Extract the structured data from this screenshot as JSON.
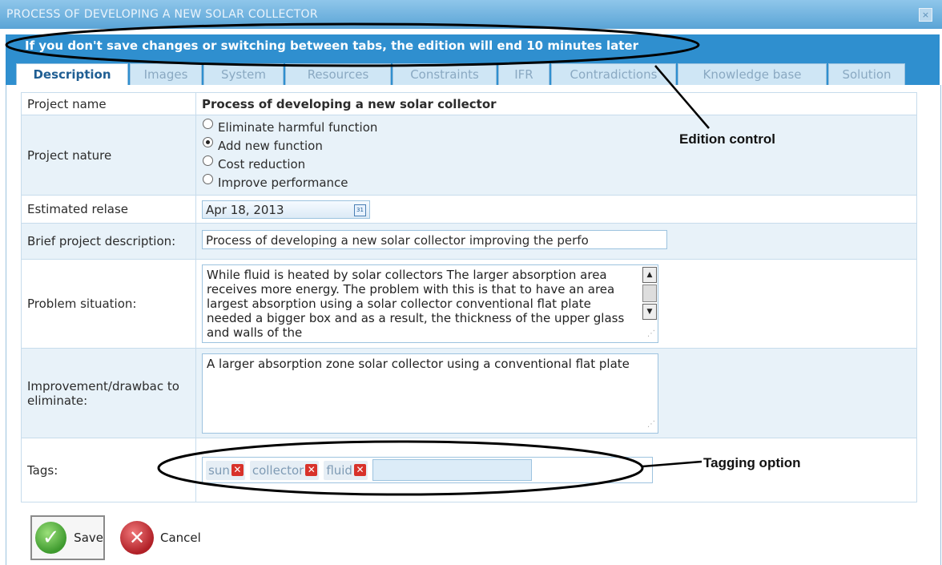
{
  "window": {
    "title": "PROCESS OF DEVELOPING A NEW SOLAR COLLECTOR",
    "close_glyph": "×"
  },
  "banner": "If you don't save changes or switching between tabs, the edition will end 10 minutes later",
  "tabs": [
    {
      "label": "Description",
      "active": true
    },
    {
      "label": "Images"
    },
    {
      "label": "System"
    },
    {
      "label": "Resources"
    },
    {
      "label": "Constraints"
    },
    {
      "label": "IFR"
    },
    {
      "label": "Contradictions"
    },
    {
      "label": "Knowledge base"
    },
    {
      "label": "Solution"
    }
  ],
  "form": {
    "project_name": {
      "label": "Project name",
      "value": "Process of developing a new solar collector"
    },
    "project_nature": {
      "label": "Project nature",
      "options": [
        "Eliminate harmful function",
        "Add new function",
        "Cost reduction",
        "Improve performance"
      ],
      "selected": "Add new function"
    },
    "estimated_release": {
      "label": "Estimated relase",
      "value": "Apr 18, 2013",
      "icon": "calendar-icon"
    },
    "brief_description": {
      "label": "Brief project description:",
      "value": "Process of developing a new solar collector improving the perfo"
    },
    "problem_situation": {
      "label": "Problem situation:",
      "value": "While fluid is heated by solar collectors The larger absorption area receives more energy. The problem with this is that to have an area largest absorption using a solar collector conventional flat plate needed a bigger box and as a result, the thickness of the upper glass and walls of the"
    },
    "improvement": {
      "label": "Improvement/drawbac to eliminate:",
      "value": "A larger absorption zone solar collector using a conventional flat plate"
    },
    "tags": {
      "label": "Tags:",
      "items": [
        "sun",
        "collector",
        "fluid"
      ],
      "remove_glyph": "✕"
    }
  },
  "buttons": {
    "save": "Save",
    "cancel": "Cancel"
  },
  "annotations": {
    "edition_control": "Edition control",
    "tagging_option": "Tagging option"
  }
}
